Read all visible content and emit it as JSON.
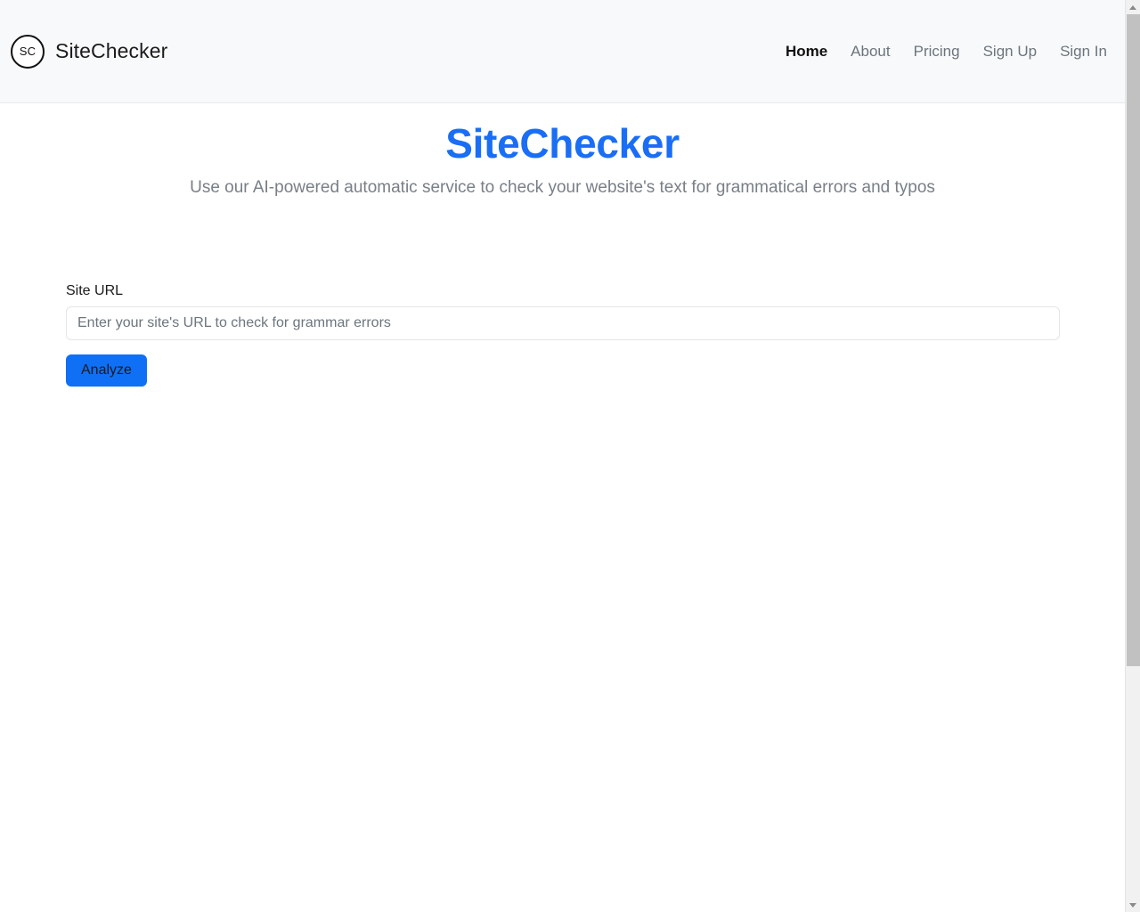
{
  "colors": {
    "brand_blue": "#1a6ef5",
    "button_blue": "#1070f5",
    "header_bg": "#f8f9fa",
    "muted_text": "#6c757d",
    "body_bg": "#ffffff"
  },
  "header": {
    "logo_initials": "SC",
    "brand_name": "SiteChecker",
    "nav": [
      {
        "label": "Home",
        "active": true
      },
      {
        "label": "About",
        "active": false
      },
      {
        "label": "Pricing",
        "active": false
      },
      {
        "label": "Sign Up",
        "active": false
      },
      {
        "label": "Sign In",
        "active": false
      }
    ]
  },
  "hero": {
    "title": "SiteChecker",
    "subtitle": "Use our AI-powered automatic service to check your website's text for grammatical errors and typos"
  },
  "form": {
    "url_label": "Site URL",
    "url_value": "",
    "url_placeholder": "Enter your site's URL to check for grammar errors",
    "submit_label": "Analyze"
  },
  "scrollbar": {
    "up_icon": "chevron-up-icon",
    "down_icon": "chevron-down-icon"
  }
}
